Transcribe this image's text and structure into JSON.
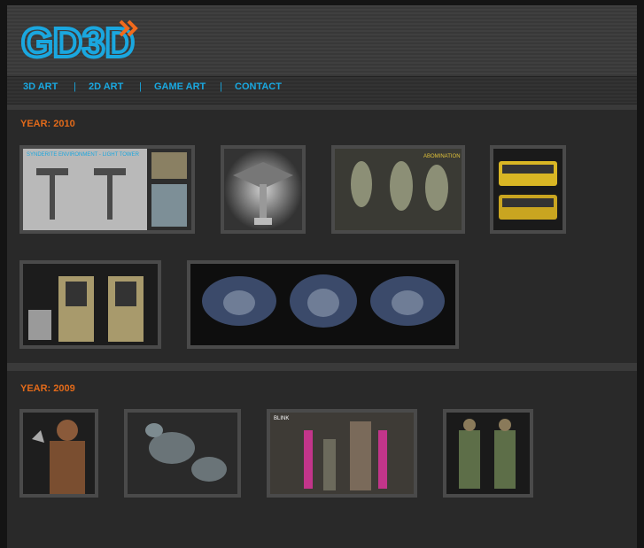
{
  "brand": {
    "logo_text": "GD3D",
    "accent": "#f26a1c",
    "logo_color": "#1aa7df"
  },
  "nav": {
    "items": [
      {
        "label": "3D ART"
      },
      {
        "label": "2D ART"
      },
      {
        "label": "GAME ART"
      },
      {
        "label": "CONTACT"
      }
    ],
    "separator": "|"
  },
  "sections": [
    {
      "year_label": "YEAR: 2010",
      "thumbs": [
        {
          "title": "SYNDERITE ENVIRONMENT - LIGHT TOWER"
        },
        {
          "title": ""
        },
        {
          "title": "ABOMINATION"
        },
        {
          "title": ""
        },
        {
          "title": ""
        },
        {
          "title": ""
        }
      ]
    },
    {
      "year_label": "YEAR: 2009",
      "thumbs": [
        {
          "title": ""
        },
        {
          "title": ""
        },
        {
          "title": "BLINK"
        },
        {
          "title": ""
        }
      ]
    }
  ]
}
